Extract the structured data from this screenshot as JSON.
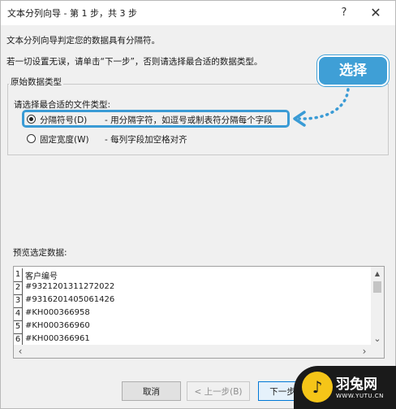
{
  "window": {
    "title": "文本分列向导 - 第 1 步，共 3 步",
    "help_glyph": "?",
    "close_glyph": "✕"
  },
  "descriptions": {
    "line1": "文本分列向导判定您的数据具有分隔符。",
    "line2": "若一切设置无误，请单击“下一步”，否则请选择最合适的数据类型。"
  },
  "group": {
    "title": "原始数据类型",
    "prompt": "请选择最合适的文件类型:",
    "options": [
      {
        "label": "分隔符号(D)",
        "description": "- 用分隔字符，如逗号或制表符分隔每个字段",
        "selected": true
      },
      {
        "label": "固定宽度(W)",
        "description": "- 每列字段加空格对齐",
        "selected": false
      }
    ]
  },
  "annotation": {
    "badge_text": "选择",
    "accent_color": "#3f9fd6"
  },
  "preview": {
    "label": "预览选定数据:",
    "lines": [
      {
        "num": "1",
        "text": "客户编号"
      },
      {
        "num": "2",
        "text": "#9321201311272022"
      },
      {
        "num": "3",
        "text": "#9316201405061426"
      },
      {
        "num": "4",
        "text": "#KH000366958"
      },
      {
        "num": "5",
        "text": "#KH000366960"
      },
      {
        "num": "6",
        "text": "#KH000366961"
      }
    ],
    "scroll_up": "▲",
    "scroll_down": "⌄",
    "scroll_left": "‹",
    "scroll_right": "›"
  },
  "buttons": {
    "cancel": "取消",
    "back": "< 上一步(B)",
    "next": "下一步"
  },
  "watermark": {
    "logo_glyph": "♪",
    "name": "羽兔网",
    "url": "WWW.YUTU.CN"
  }
}
